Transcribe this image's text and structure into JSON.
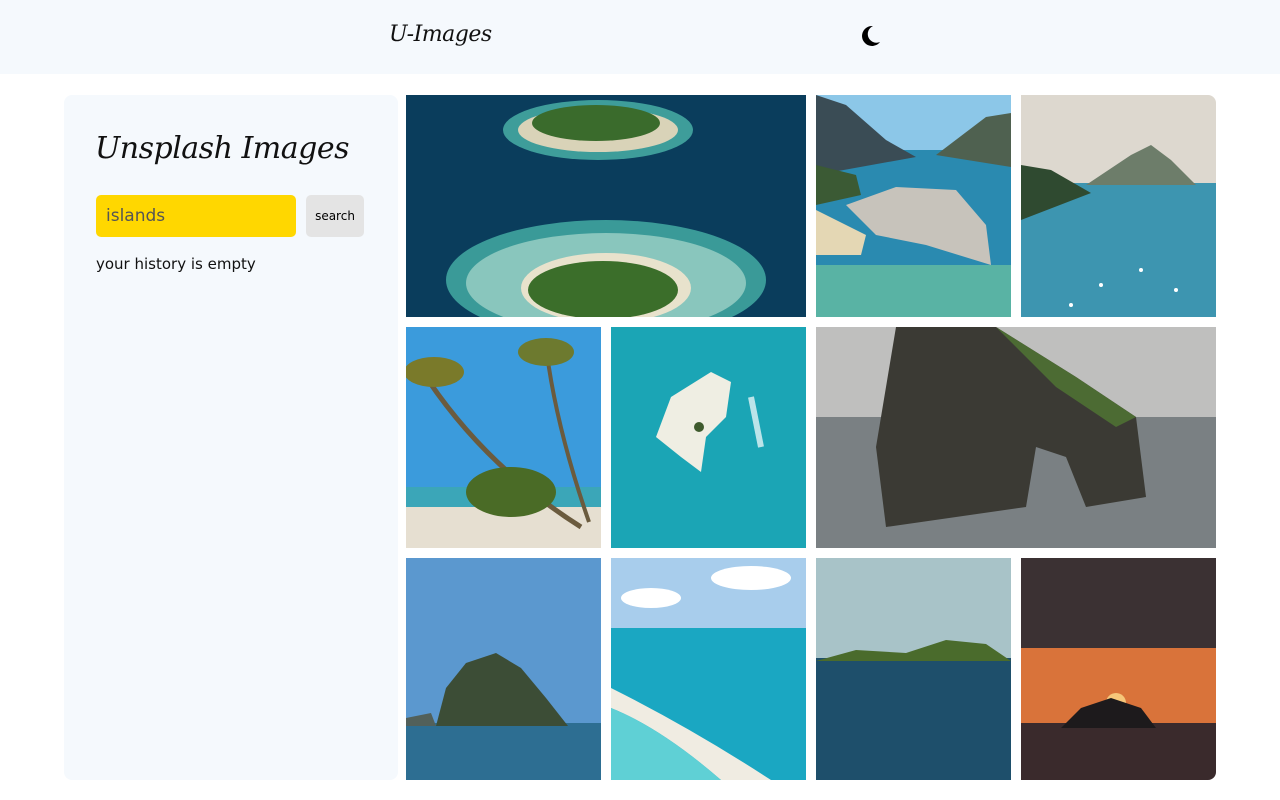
{
  "header": {
    "logo": "U-Images",
    "theme_toggle_icon": "moon-icon"
  },
  "sidebar": {
    "title": "Unsplash Images",
    "search": {
      "value": "islands",
      "button_label": "search"
    },
    "history_text": "your history is empty"
  },
  "gallery": {
    "images": [
      {
        "subject": "two atoll islands aerial"
      },
      {
        "subject": "limestone cliffs lagoon"
      },
      {
        "subject": "bay with boats and peaks"
      },
      {
        "subject": "palm trees on beach"
      },
      {
        "subject": "small sandbar island aerial"
      },
      {
        "subject": "sea stack arch"
      },
      {
        "subject": "rocky island at sea"
      },
      {
        "subject": "white sand sandbar turquoise water"
      },
      {
        "subject": "green island horizon"
      },
      {
        "subject": "island at sunset"
      }
    ]
  },
  "colors": {
    "header_bg": "#f5f9fd",
    "sidebar_bg": "#f5f9fd",
    "search_bg": "#ffd700",
    "button_bg": "#e4e4e4"
  }
}
